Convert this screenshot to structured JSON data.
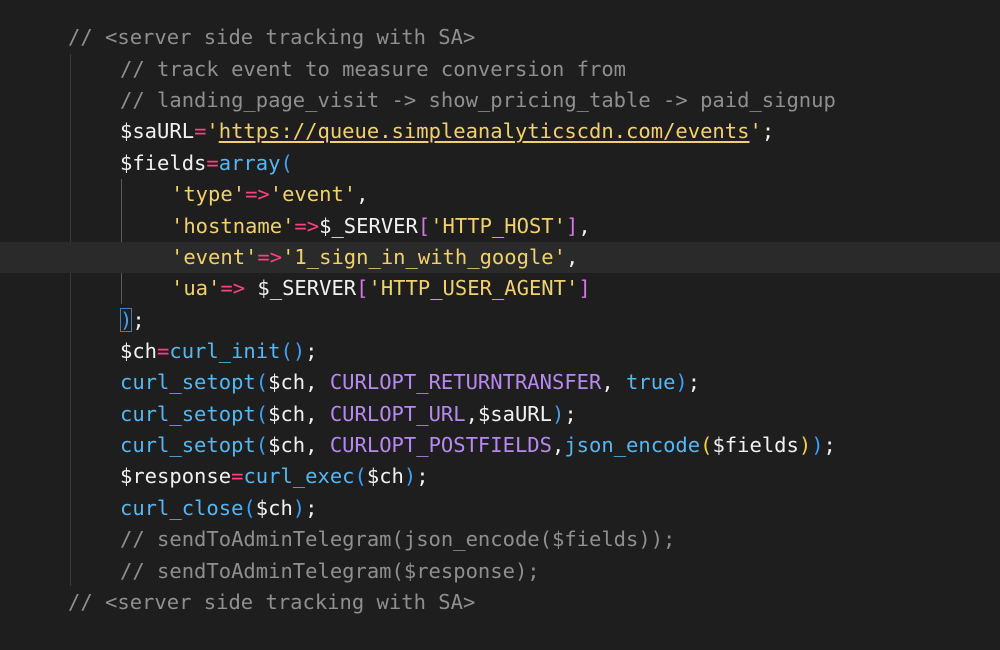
{
  "editor": {
    "lines": {
      "l1": {
        "comment": "// <server side tracking with SA>"
      },
      "l2": {
        "comment": "// track event to measure conversion from"
      },
      "l3": {
        "comment": "// landing_page_visit -> show_pricing_table -> paid_signup"
      },
      "l4": {
        "var": "$saURL",
        "op": "=",
        "q1": "'",
        "url": "https://queue.simpleanalyticscdn.com/events",
        "q2": "'",
        "end": ";"
      },
      "l5": {
        "var": "$fields",
        "op": "=",
        "fn": "array",
        "open": "("
      },
      "l6": {
        "key": "'type'",
        "arrow": "=>",
        "val": "'event'",
        "end": ","
      },
      "l7": {
        "key": "'hostname'",
        "arrow": "=>",
        "var": "$_SERVER",
        "bo": "[",
        "val": "'HTTP_HOST'",
        "bc": "]",
        "end": ","
      },
      "l8": {
        "key": "'event'",
        "arrow": "=>",
        "val": "'1_sign_in_with_google'",
        "end": ","
      },
      "l9": {
        "key": "'ua'",
        "arrow": "=>",
        "sp": " ",
        "var": "$_SERVER",
        "bo": "[",
        "val": "'HTTP_USER_AGENT'",
        "bc": "]"
      },
      "l10": {
        "close": ")",
        "end": ";"
      },
      "l11": {
        "var": "$ch",
        "op": "=",
        "fn": "curl_init",
        "open": "(",
        "close": ")",
        "end": ";"
      },
      "l12": {
        "fn": "curl_setopt",
        "open": "(",
        "arg1": "$ch",
        "sep1": ", ",
        "const": "CURLOPT_RETURNTRANSFER",
        "sep2": ", ",
        "bool": "true",
        "close": ")",
        "end": ";"
      },
      "l13": {
        "fn": "curl_setopt",
        "open": "(",
        "arg1": "$ch",
        "sep1": ", ",
        "const": "CURLOPT_URL",
        "sep2": ",",
        "arg3": "$saURL",
        "close": ")",
        "end": ";"
      },
      "l14": {
        "fn": "curl_setopt",
        "open": "(",
        "arg1": "$ch",
        "sep1": ", ",
        "const": "CURLOPT_POSTFIELDS",
        "sep2": ",",
        "fn2": "json_encode",
        "open2": "(",
        "arg3": "$fields",
        "close2": ")",
        "close": ")",
        "end": ";"
      },
      "l15": {
        "var": "$response",
        "op": "=",
        "fn": "curl_exec",
        "open": "(",
        "arg1": "$ch",
        "close": ")",
        "end": ";"
      },
      "l16": {
        "fn": "curl_close",
        "open": "(",
        "arg1": "$ch",
        "close": ")",
        "end": ";"
      },
      "l17": {
        "comment": "// sendToAdminTelegram(json_encode($fields));"
      },
      "l18": {
        "comment": "// sendToAdminTelegram($response);"
      },
      "l19": {
        "comment": "// <server side tracking with SA>"
      }
    }
  }
}
